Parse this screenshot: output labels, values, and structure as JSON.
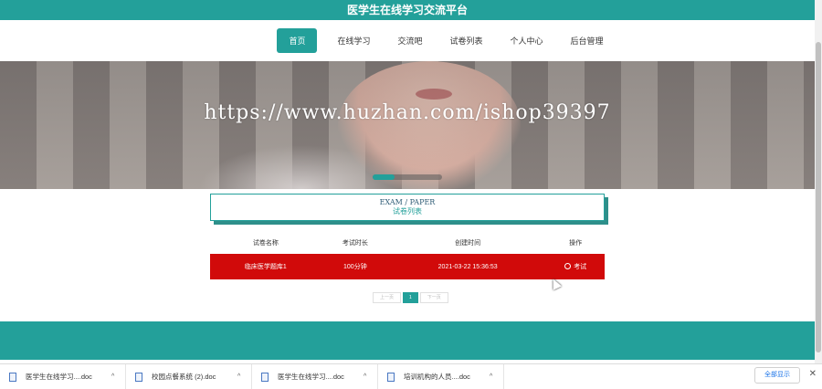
{
  "header": {
    "title": "医学生在线学习交流平台"
  },
  "nav": [
    {
      "label": "首页",
      "active": true
    },
    {
      "label": "在线学习",
      "active": false
    },
    {
      "label": "交流吧",
      "active": false
    },
    {
      "label": "试卷列表",
      "active": false
    },
    {
      "label": "个人中心",
      "active": false
    },
    {
      "label": "后台管理",
      "active": false
    }
  ],
  "banner": {
    "watermark": "https://www.huzhan.com/ishop39397"
  },
  "section": {
    "title_en": "EXAM / PAPER",
    "title_cn": "试卷列表"
  },
  "table": {
    "headers": [
      "试卷名称",
      "考试时长",
      "创建时间",
      "操作"
    ],
    "rows": [
      {
        "name": "临床医学题库1",
        "duration": "100分钟",
        "created": "2021-03-22 15:36:53",
        "action": "考试"
      }
    ]
  },
  "pager": {
    "prev": "上一页",
    "current": "1",
    "next": "下一页"
  },
  "downloads": {
    "items": [
      {
        "name": "医学生在线学习....doc"
      },
      {
        "name": "校园点餐系统 (2).doc"
      },
      {
        "name": "医学生在线学习....doc"
      },
      {
        "name": "培训机构的人员....doc"
      }
    ],
    "show_all": "全部显示"
  },
  "colors": {
    "accent": "#23a09a",
    "row_highlight": "#d10a0a"
  }
}
